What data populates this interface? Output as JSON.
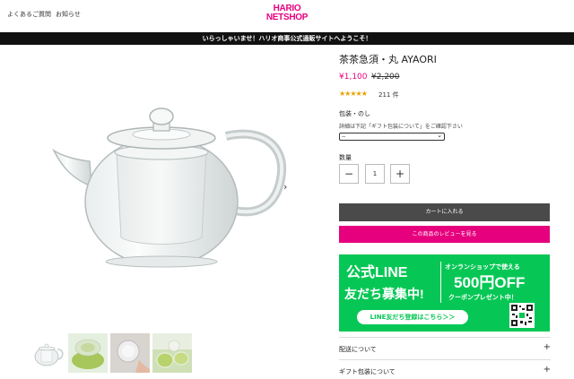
{
  "header": {
    "faq_label": "よくあるご質問",
    "news_label": "お知らせ",
    "logo_line1": "HARIO",
    "logo_line2": "NETSHOP",
    "announcement": "いらっしゃいませ！ハリオ商事公式通販サイトへようこそ！"
  },
  "product": {
    "title": "茶茶急須・丸 AYAORI",
    "price": "¥1,100",
    "original_price": "¥2,200",
    "rating": 5,
    "stars_text": "★★★★★",
    "review_count": "211 件",
    "wrapping_label": "包装・のし",
    "wrapping_note": "詳細は下記「ギフト包装について」をご確認下さい",
    "wrapping_selected": "--",
    "quantity_label": "数量",
    "quantity": "1",
    "minus_label": "−",
    "plus_label": "+",
    "cart_button": "カートに入れる",
    "review_button": "この商品のレビューを見る"
  },
  "gallery": {
    "next_arrow": "›",
    "thumbnails": [
      "teapot-photo",
      "green-tea-photo",
      "strainer-photo",
      "tea-cups-photo"
    ]
  },
  "banner": {
    "left_line1": "公式LINE",
    "left_line2": "友だち募集中!",
    "right_line1": "オンランショップで使える",
    "right_line2": "500円OFF",
    "right_line3": "クーポンプレゼント中！",
    "button": "LINE友だち登録はこちら＞＞"
  },
  "accordion": [
    {
      "label": "配送について",
      "icon": "+"
    },
    {
      "label": "ギフト包装について",
      "icon": "+"
    }
  ],
  "colors": {
    "brand": "#e6007e",
    "line_green": "#06c755",
    "cart_button": "#4a4a4a",
    "star": "#e8a200"
  }
}
